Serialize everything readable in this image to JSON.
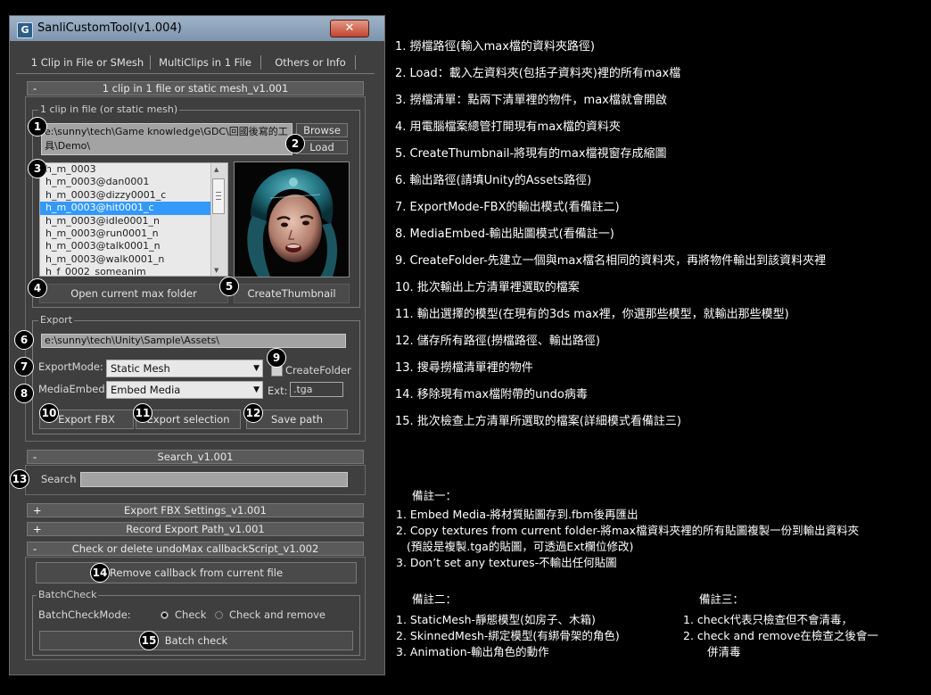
{
  "window": {
    "title": "SanliCustomTool(v1.004)",
    "app_icon_glyph": "G",
    "close_glyph": "✕"
  },
  "tabs": [
    "1 Clip in File or SMesh",
    "MultiClips in 1 File",
    "Others or Info"
  ],
  "rollout_main": {
    "sign": "-",
    "title": "1 clip in 1 file or static mesh_v1.001"
  },
  "clip_group": {
    "label": "1 clip in file (or static mesh)",
    "path": "e:\\sunny\\tech\\Game knowledge\\GDC\\回國後寫的工具\\Demo\\",
    "browse": "Browse",
    "load": "Load",
    "list_items": [
      "h_m_0003",
      "h_m_0003@dan0001",
      "h_m_0003@dizzy0001_c",
      "h_m_0003@hit0001_c",
      "h_m_0003@idle0001_n",
      "h_m_0003@run0001_n",
      "h_m_0003@talk0001_n",
      "h_m_0003@walk0001_n",
      "h_f_0002_someanim"
    ],
    "selected_index": 3,
    "open_folder": "Open current max folder",
    "create_thumbnail": "CreateThumbnail"
  },
  "export_group": {
    "label": "Export",
    "path": "e:\\sunny\\tech\\Unity\\Sample\\Assets\\",
    "export_mode_label": "ExportMode:",
    "export_mode_value": "Static Mesh",
    "create_folder_label": "CreateFolder",
    "create_folder_checked": false,
    "media_embed_label": "MediaEmbed:",
    "media_embed_value": "Embed Media",
    "ext_label": "Ext:",
    "ext_value": ".tga",
    "export_fbx": "Export FBX",
    "export_selection": "Export selection",
    "save_path": "Save path"
  },
  "search_rollout": {
    "sign": "-",
    "title": "Search_v1.001",
    "label": "Search",
    "value": ""
  },
  "collapsed_rollouts": [
    {
      "sign": "+",
      "title": "Export FBX Settings_v1.001"
    },
    {
      "sign": "+",
      "title": "Record Export Path_v1.001"
    }
  ],
  "undo_rollout": {
    "sign": "-",
    "title": "Check or delete undoMax callbackScript_v1.002",
    "remove_button": "Remove callback from current file",
    "batch_group_label": "BatchCheck",
    "mode_label": "BatchCheckMode:",
    "mode_options": [
      "Check",
      "Check and remove"
    ],
    "mode_selected": 0,
    "batch_button": "Batch check"
  },
  "badges": [
    "1",
    "2",
    "3",
    "4",
    "5",
    "6",
    "7",
    "8",
    "9",
    "10",
    "11",
    "12",
    "13",
    "14",
    "15"
  ],
  "notes": [
    "1. 撈檔路徑(輸入max檔的資料夾路徑)",
    "2. Load：載入左資料夾(包括子資料夾)裡的所有max檔",
    "3. 撈檔清單：點兩下清單裡的物件，max檔就會開啟",
    "4. 用電腦檔案總管打開現有max檔的資料夾",
    "5. CreateThumbnail-將現有的max檔視窗存成縮圖",
    "6. 輸出路徑(請填Unity的Assets路徑)",
    "7. ExportMode-FBX的輸出模式(看備註二)",
    "8. MediaEmbed-輸出貼圖模式(看備註一)",
    "9. CreateFolder-先建立一個與max檔名相同的資料夾，再將物件輸出到該資料夾裡",
    "10. 批次輸出上方清單裡選取的檔案",
    "11. 輸出選擇的模型(在現有的3ds max裡，你選那些模型，就輸出那些模型)",
    "12. 儲存所有路徑(撈檔路徑、輸出路徑)",
    "13. 搜尋撈檔清單裡的物件",
    "14. 移除現有max檔附帶的undo病毒",
    "15. 批次檢查上方清單所選取的檔案(詳細模式看備註三)"
  ],
  "remark1": {
    "title": "備註一：",
    "lines": [
      "1. Embed Media-將材質貼圖存到.fbm後再匯出",
      "2. Copy textures from current folder-將max檔資料夾裡的所有貼圖複製一份到輸出資料夾",
      "(預設是複製.tga的貼圖，可透過Ext欄位修改)",
      "3. Don’t set any textures-不輸出任何貼圖"
    ]
  },
  "remark2": {
    "title": "備註二：",
    "lines": [
      "1. StaticMesh-靜態模型(如房子、木箱)",
      "2. SkinnedMesh-綁定模型(有綁骨架的角色)",
      "3. Animation-輸出角色的動作"
    ]
  },
  "remark3": {
    "title": "備註三：",
    "lines": [
      "1. check代表只檢查但不會清毒，",
      "2. check and remove在檢查之後會一",
      "併清毒"
    ]
  },
  "colors": {
    "selection": "#3399ff",
    "panel": "#3f3f3f",
    "titlebar": "#8ea4ba"
  }
}
